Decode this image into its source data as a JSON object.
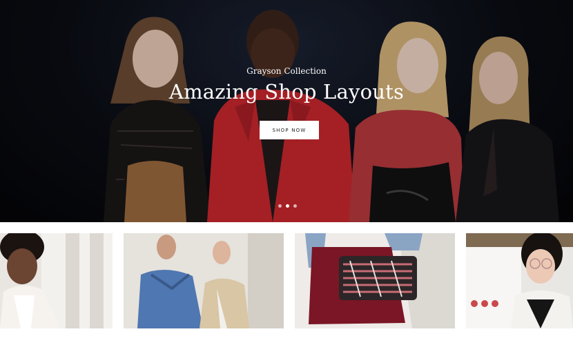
{
  "hero": {
    "eyebrow": "Grayson Collection",
    "headline": "Amazing Shop Layouts",
    "cta_label": "SHOP NOW",
    "slides_total": 3,
    "active_slide": 1
  },
  "tiles": [
    {
      "name": "Woman in white blazer"
    },
    {
      "name": "Two men in denim and trench coat"
    },
    {
      "name": "Red pleated skirt with patterned clutch"
    },
    {
      "name": "Woman with round glasses"
    }
  ],
  "colors": {
    "hero_dark": "#0b0d14",
    "button_bg": "#ffffff",
    "button_text": "#222222",
    "accent_red": "#c8282e"
  }
}
